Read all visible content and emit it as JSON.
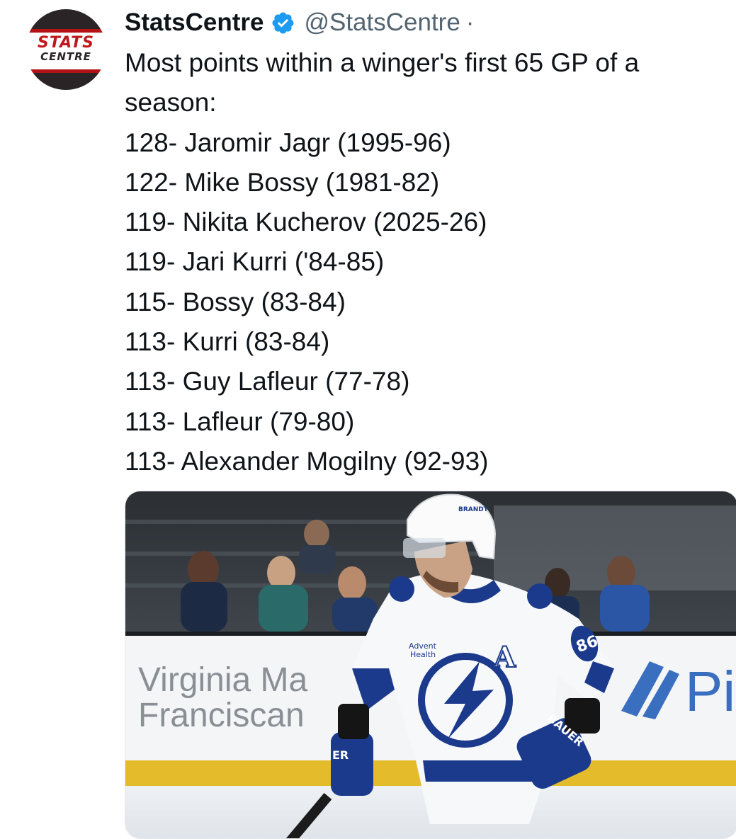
{
  "author": {
    "display_name": "StatsCentre",
    "handle": "@StatsCentre",
    "separator": "·",
    "avatar_logo_top": "STATS",
    "avatar_logo_bottom": "CENTRE",
    "verified": true,
    "verified_icon": "verified-badge-icon"
  },
  "tweet": {
    "intro": "Most points within a winger's first 65 GP of a season:",
    "lines": [
      "128- Jaromir Jagr (1995-96)",
      "122- Mike Bossy (1981-82)",
      "119- Nikita Kucherov (2025-26)",
      "119- Jari Kurri ('84-85)",
      "115- Bossy (83-84)",
      "113- Kurri (83-84)",
      "113- Guy Lafleur (77-78)",
      "113- Lafleur (79-80)",
      "113- Alexander Mogilny (92-93)"
    ]
  },
  "media": {
    "board_text_line1": "Virginia Ma",
    "board_text_line2": "Franciscan",
    "board_right_text": "Pi",
    "jersey_sponsor_line1": "Advent",
    "jersey_sponsor_line2": "Health",
    "jersey_letter": "A",
    "jersey_number": "86",
    "helmet_brand": "BRANDT",
    "glove_brand": "BAUER",
    "glove_left_text": "ER"
  },
  "colors": {
    "verified_blue": "#1d9bf0",
    "handle_gray": "#536471",
    "text": "#0f1419",
    "lightning_blue": "#1b3a8c",
    "logo_red": "#c0171d"
  }
}
